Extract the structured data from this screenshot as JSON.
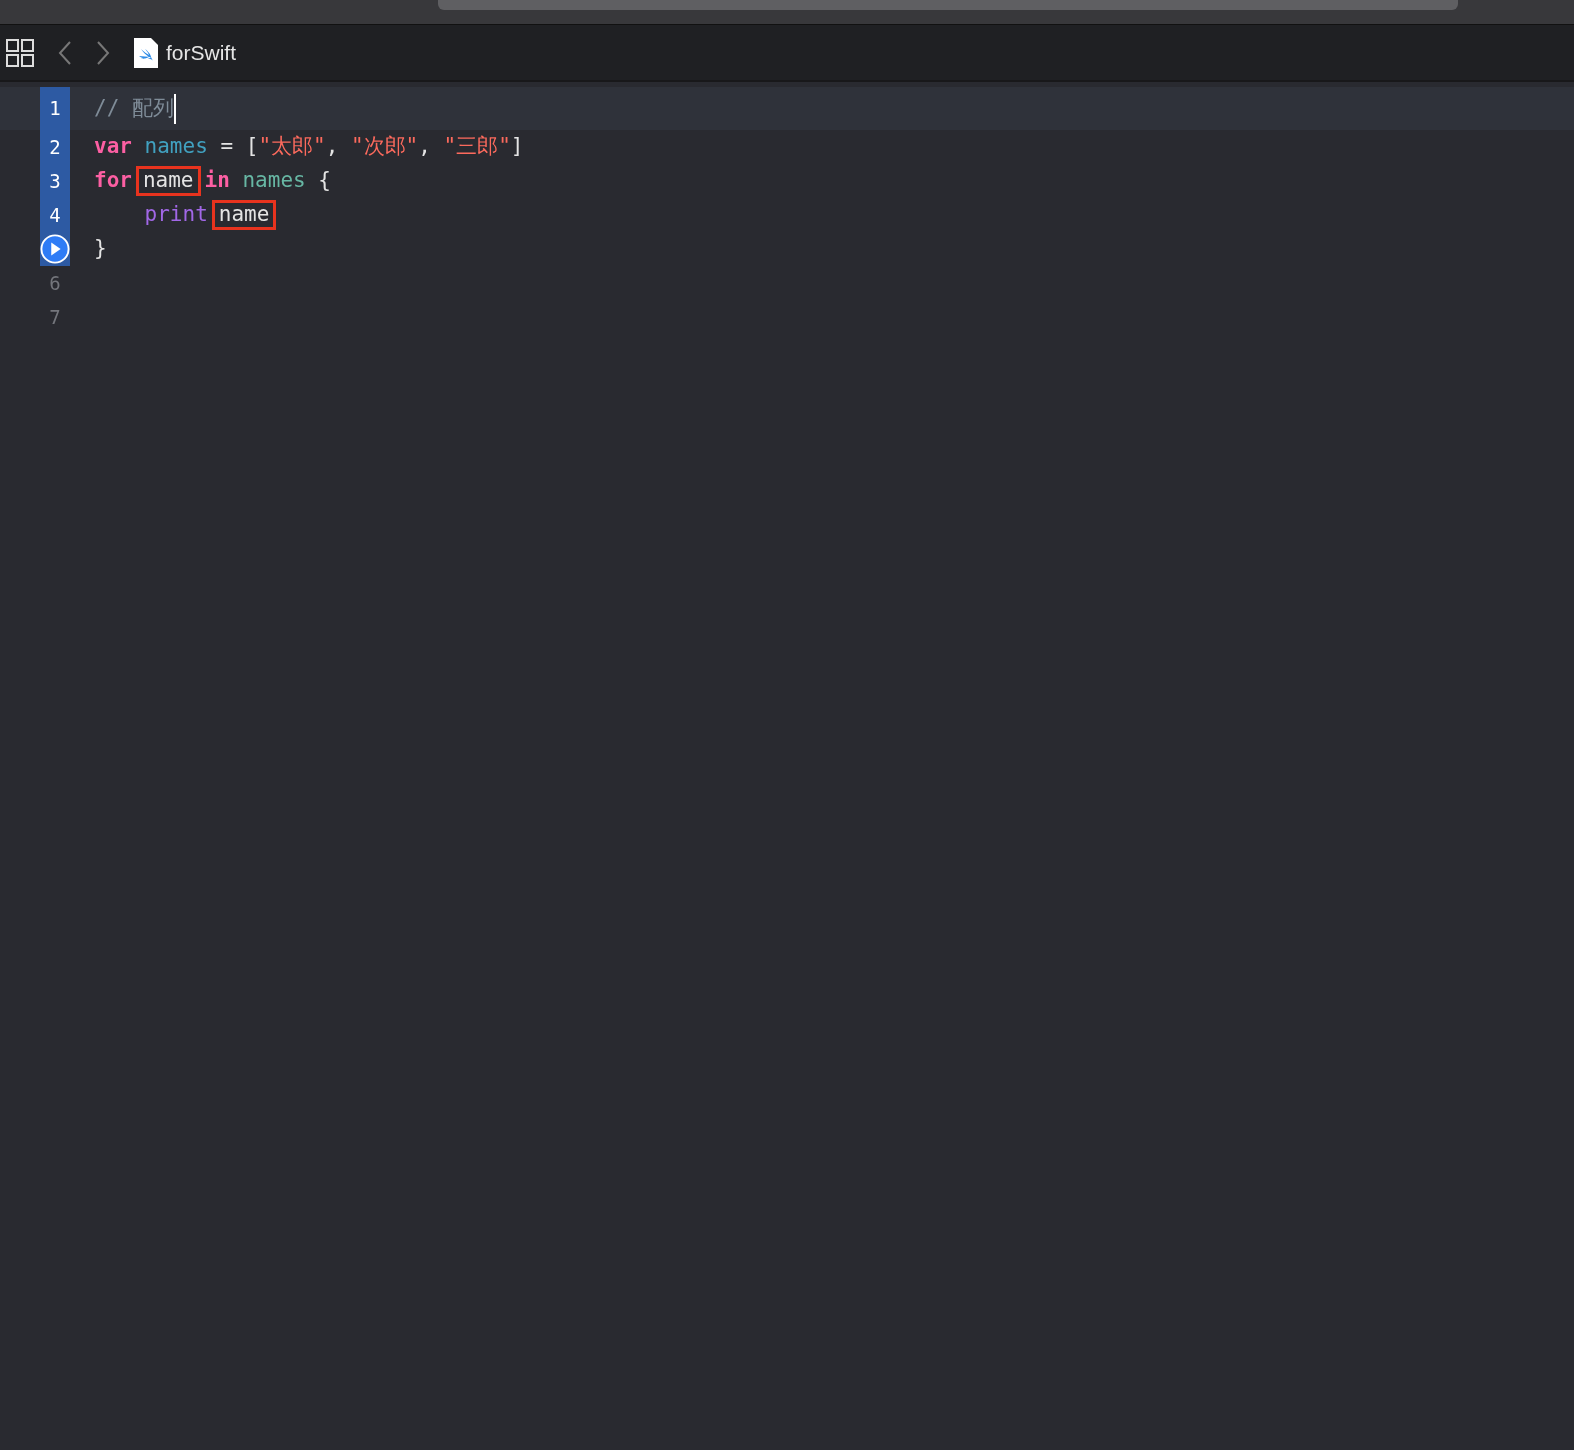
{
  "tab": {
    "title": "forSwift"
  },
  "lines": [
    {
      "number": "1",
      "in_range": true,
      "current": true,
      "kind": "text",
      "indent": false,
      "tokens": [
        {
          "text": "// 配列",
          "kind": "comment",
          "sp": false,
          "boxed": false
        }
      ]
    },
    {
      "number": "2",
      "in_range": true,
      "current": false,
      "kind": "text",
      "indent": false,
      "tokens": [
        {
          "text": "var",
          "kind": "keyword",
          "sp": false,
          "boxed": false
        },
        {
          "text": "names",
          "kind": "declaration",
          "sp": true,
          "boxed": false
        },
        {
          "text": "= [",
          "kind": "plain",
          "sp": true,
          "boxed": false
        },
        {
          "text": "\"太郎\"",
          "kind": "string",
          "sp": false,
          "boxed": false
        },
        {
          "text": ",",
          "kind": "plain",
          "sp": false,
          "boxed": false
        },
        {
          "text": "\"次郎\"",
          "kind": "string",
          "sp": true,
          "boxed": false
        },
        {
          "text": ",",
          "kind": "plain",
          "sp": false,
          "boxed": false
        },
        {
          "text": "\"三郎\"",
          "kind": "string",
          "sp": true,
          "boxed": false
        },
        {
          "text": "]",
          "kind": "plain",
          "sp": false,
          "boxed": false
        }
      ]
    },
    {
      "number": "3",
      "in_range": true,
      "current": false,
      "kind": "text",
      "indent": false,
      "tokens": [
        {
          "text": "for",
          "kind": "keyword",
          "sp": false,
          "boxed": false
        },
        {
          "text": "name",
          "kind": "plain",
          "sp": false,
          "boxed": true
        },
        {
          "text": "in",
          "kind": "keyword",
          "sp": false,
          "boxed": false
        },
        {
          "text": "names",
          "kind": "reference",
          "sp": true,
          "boxed": false
        },
        {
          "text": "{",
          "kind": "plain",
          "sp": true,
          "boxed": false
        }
      ]
    },
    {
      "number": "4",
      "in_range": true,
      "current": false,
      "kind": "text",
      "indent": true,
      "tokens": [
        {
          "text": "print",
          "kind": "function",
          "sp": false,
          "boxed": false
        },
        {
          "text": "name",
          "kind": "plain",
          "sp": false,
          "boxed": true
        }
      ]
    },
    {
      "in_range": true,
      "current": false,
      "kind": "run",
      "indent": false,
      "tokens": [
        {
          "text": "}",
          "kind": "plain",
          "sp": false,
          "boxed": false
        }
      ]
    },
    {
      "number": "6",
      "in_range": false,
      "current": false,
      "kind": "text"
    },
    {
      "number": "7",
      "in_range": false,
      "current": false,
      "kind": "text"
    }
  ]
}
